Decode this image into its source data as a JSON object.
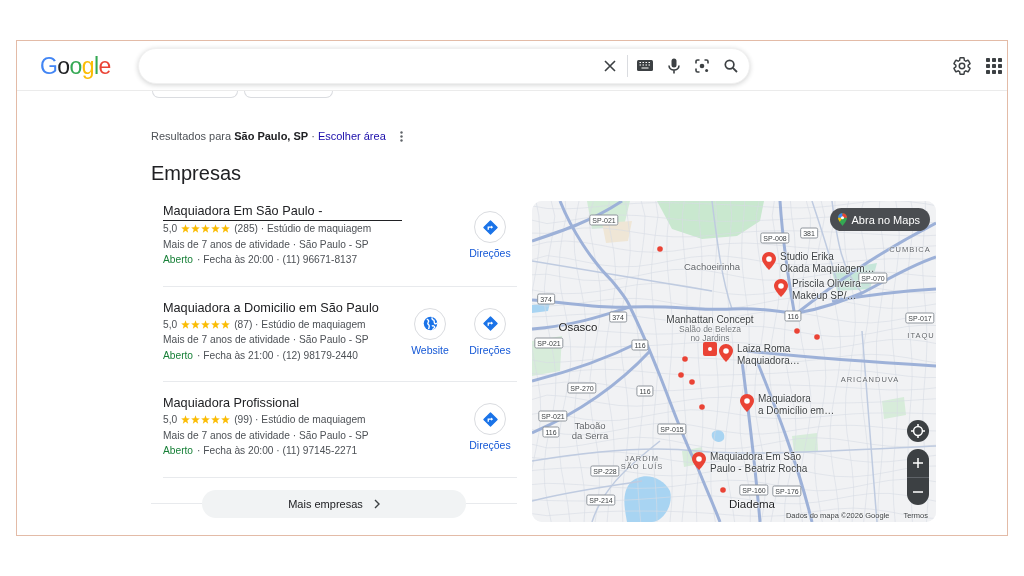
{
  "header": {
    "logo": "Google"
  },
  "results": {
    "text": "Resultados para **São Paulo, SP** ·",
    "link": "Escolher área"
  },
  "section_title": "Empresas",
  "listings": [
    {
      "title": "Maquiadora Em São Paulo -",
      "hovered": true,
      "rating": "5,0",
      "stars": 5,
      "reviews_category": "(285) · Estúdio de maquiagem",
      "info": "Mais de 7 anos de atividade · São Paulo - SP",
      "status": "Aberto",
      "open": true,
      "details": "· Fecha às 20:00 · (11) 96671-8137",
      "actions": [
        {
          "kind": "directions",
          "label": "Direções"
        }
      ]
    },
    {
      "title": "Maquiadora a Domicilio em São Paulo",
      "hovered": false,
      "rating": "5,0",
      "stars": 5,
      "reviews_category": "(87) · Estúdio de maquiagem",
      "info": "Mais de 7 anos de atividade · São Paulo - SP",
      "status": "Aberto",
      "open": true,
      "details": "· Fecha às 21:00 · (12) 98179-2440",
      "actions": [
        {
          "kind": "website",
          "label": "Website"
        },
        {
          "kind": "directions",
          "label": "Direções"
        }
      ]
    },
    {
      "title": "Maquiadora Profissional",
      "hovered": false,
      "rating": "5,0",
      "stars": 5,
      "reviews_category": "(99) · Estúdio de maquiagem",
      "info": "Mais de 7 anos de atividade · São Paulo - SP",
      "status": "Aberto",
      "open": true,
      "details": "· Fecha às 20:00 · (11) 97145-2271",
      "actions": [
        {
          "kind": "directions",
          "label": "Direções"
        }
      ]
    }
  ],
  "more_button": "Mais empresas",
  "map": {
    "open_button": "Abra no Maps",
    "place_labels": [
      {
        "kind": "district",
        "lines": [
          "CUMBICA"
        ]
      },
      {
        "kind": "suburb",
        "lines": [
          "Cachoeirinha"
        ]
      },
      {
        "kind": "city",
        "lines": [
          "Osasco"
        ]
      },
      {
        "kind": "poi",
        "lines": [
          "Manhattan Concept",
          "Salão de Beleza",
          "no Jardins"
        ]
      },
      {
        "kind": "district",
        "lines": [
          "ITAQU"
        ]
      },
      {
        "kind": "district",
        "lines": [
          "ARICANDUVA"
        ]
      },
      {
        "kind": "suburb",
        "lines": [
          "Taboão",
          "da Serra"
        ]
      },
      {
        "kind": "district",
        "lines": [
          "JARDIM",
          "SÃO LUÍS"
        ]
      },
      {
        "kind": "city",
        "lines": [
          "Diadema"
        ]
      }
    ],
    "route_labels": [
      "SP-021",
      "SP-008",
      "381",
      "SP-070",
      "374",
      "374",
      "116",
      "SP-017",
      "SP-021",
      "116",
      "SP-270",
      "116",
      "SP-021",
      "116",
      "SP-015",
      "SP-228",
      "SP-214",
      "SP-160",
      "SP-176"
    ],
    "pins": [
      {
        "lines": [
          "Studio Erika",
          "Okada Maquiagem…"
        ]
      },
      {
        "lines": [
          "Priscila Oliveira",
          "Makeup SP/…"
        ]
      },
      {
        "lines": [
          "Laiza Roma",
          "Maquiadora…"
        ]
      },
      {
        "lines": [
          "Maquiadora",
          "a Domicílio em…"
        ]
      },
      {
        "lines": [
          "Maquiadora Em São",
          "Paulo - Beatriz Rocha"
        ]
      }
    ],
    "attribution": "Dados do mapa ©2026 Google",
    "terms": "Termos"
  }
}
